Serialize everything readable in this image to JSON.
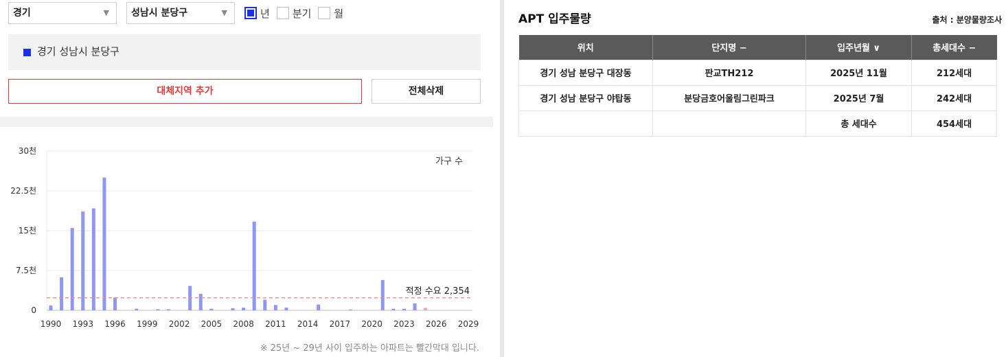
{
  "filters": {
    "province": "경기",
    "district": "성남시 분당구",
    "period_options": [
      {
        "label": "년",
        "checked": true
      },
      {
        "label": "분기",
        "checked": false
      },
      {
        "label": "월",
        "checked": false
      }
    ]
  },
  "selected_region": "경기 성남시 분당구",
  "buttons": {
    "add_region": "대체지역 추가",
    "delete_all": "전체삭제"
  },
  "footnote": "※ 25년 ~ 29년 사이 입주하는 아파트는 빨간막대 입니다.",
  "chart_data": {
    "type": "bar",
    "title": "",
    "series_label": "가구 수",
    "xlabel": "",
    "ylabel": "",
    "ylim": [
      0,
      30000
    ],
    "y_ticks": [
      {
        "value": 0,
        "label": "0"
      },
      {
        "value": 7500,
        "label": "7.5천"
      },
      {
        "value": 15000,
        "label": "15천"
      },
      {
        "value": 22500,
        "label": "22.5천"
      },
      {
        "value": 30000,
        "label": "30천"
      }
    ],
    "x_ticks": [
      1990,
      1993,
      1996,
      1999,
      2002,
      2005,
      2008,
      2011,
      2014,
      2017,
      2020,
      2023,
      2026,
      2029
    ],
    "x_range": [
      1990,
      2029
    ],
    "grid": true,
    "reference_line": {
      "label": "적정 수요 2,354",
      "value": 2354,
      "color": "#f28b82"
    },
    "colors": {
      "normal": "#8e97f2",
      "future": "#f7a49a"
    },
    "bars": [
      {
        "year": 1990,
        "value": 900
      },
      {
        "year": 1991,
        "value": 6200
      },
      {
        "year": 1992,
        "value": 15500
      },
      {
        "year": 1993,
        "value": 18600
      },
      {
        "year": 1994,
        "value": 19200
      },
      {
        "year": 1995,
        "value": 25000
      },
      {
        "year": 1996,
        "value": 2400
      },
      {
        "year": 1998,
        "value": 300
      },
      {
        "year": 2000,
        "value": 200
      },
      {
        "year": 2001,
        "value": 200
      },
      {
        "year": 2003,
        "value": 4600
      },
      {
        "year": 2004,
        "value": 3100
      },
      {
        "year": 2005,
        "value": 300
      },
      {
        "year": 2007,
        "value": 400
      },
      {
        "year": 2008,
        "value": 500
      },
      {
        "year": 2009,
        "value": 16700
      },
      {
        "year": 2010,
        "value": 2000
      },
      {
        "year": 2011,
        "value": 1000
      },
      {
        "year": 2012,
        "value": 500
      },
      {
        "year": 2015,
        "value": 1100
      },
      {
        "year": 2018,
        "value": 150
      },
      {
        "year": 2021,
        "value": 5700
      },
      {
        "year": 2022,
        "value": 300
      },
      {
        "year": 2023,
        "value": 300
      },
      {
        "year": 2024,
        "value": 1300
      },
      {
        "year": 2025,
        "value": 454,
        "future": true
      }
    ]
  },
  "apt": {
    "title": "APT 입주물량",
    "source": "출처 : 분양물량조사",
    "headers": [
      "위치",
      "단지명 −",
      "입주년월 ∨",
      "총세대수 −"
    ],
    "rows": [
      [
        "경기 성남 분당구 대장동",
        "판교TH212",
        "2025년 11월",
        "212세대"
      ],
      [
        "경기 성남 분당구 야탑동",
        "분당금호어울림그린파크",
        "2025년 7월",
        "242세대"
      ]
    ],
    "total_label": "총 세대수",
    "total_value": "454세대"
  }
}
